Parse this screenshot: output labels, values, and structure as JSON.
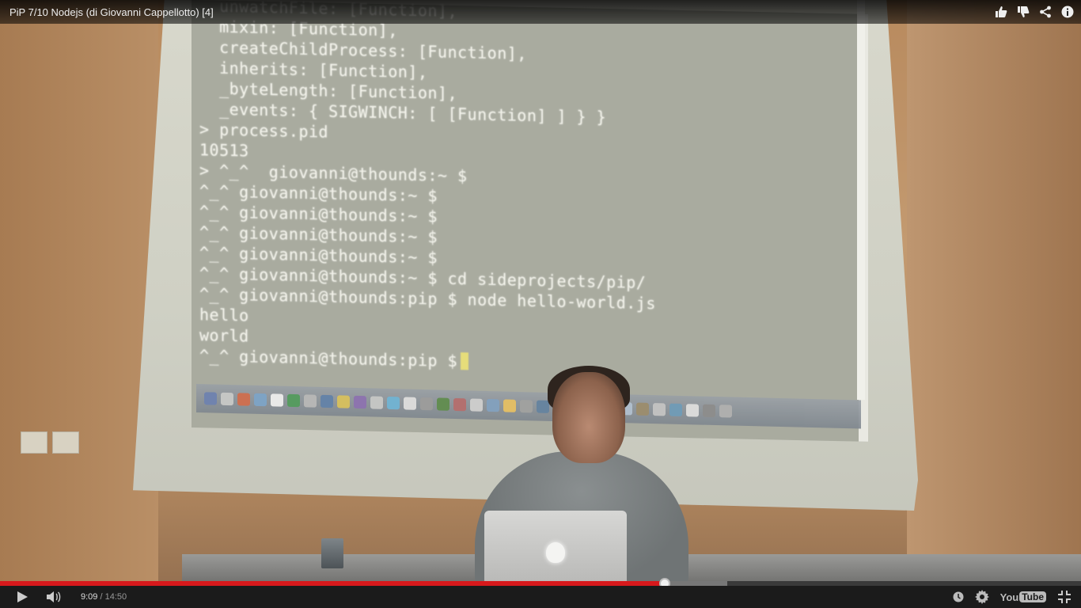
{
  "video": {
    "title": "PiP 7/10 Nodejs (di Giovanni Cappellotto) [4]",
    "terminal_lines": [
      "  unwatchFile: [Function],",
      "  mixin: [Function],",
      "  createChildProcess: [Function],",
      "  inherits: [Function],",
      "  _byteLength: [Function],",
      "  _events: { SIGWINCH: [ [Function] ] } }",
      "> process.pid",
      "10513",
      "> ^_^  giovanni@thounds:~ $",
      "^_^ giovanni@thounds:~ $",
      "^_^ giovanni@thounds:~ $",
      "^_^ giovanni@thounds:~ $",
      "^_^ giovanni@thounds:~ $",
      "^_^ giovanni@thounds:~ $ cd sideprojects/pip/",
      "^_^ giovanni@thounds:pip $ node hello-world.js",
      "hello",
      "world",
      "^_^ giovanni@thounds:pip $"
    ]
  },
  "topbar": {
    "actions": [
      {
        "name": "like-icon",
        "label": "Like"
      },
      {
        "name": "dislike-icon",
        "label": "Dislike"
      },
      {
        "name": "share-icon",
        "label": "Share"
      },
      {
        "name": "info-icon",
        "label": "Info"
      }
    ]
  },
  "player": {
    "current_time": "9:09",
    "separator": "/",
    "duration": "14:50",
    "progress_fraction": 0.615,
    "buffered_fraction": 0.673,
    "logo": {
      "you": "You",
      "tube": "Tube"
    },
    "colors": {
      "played": "#d7191c",
      "control_bg": "#1b1b1b"
    }
  }
}
